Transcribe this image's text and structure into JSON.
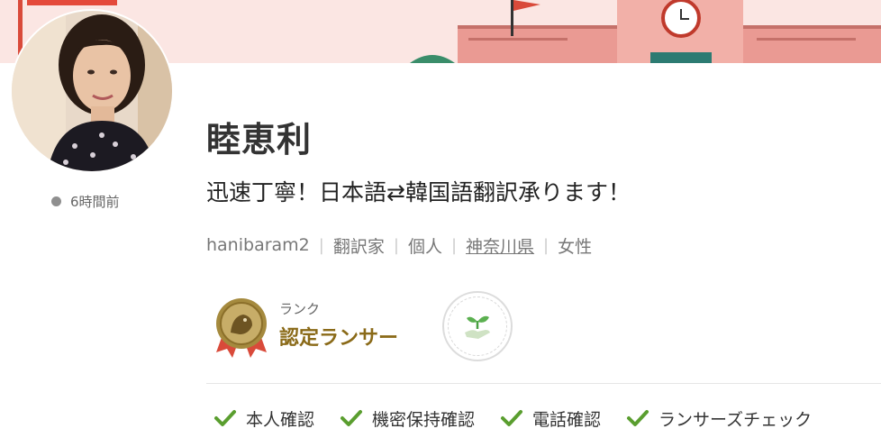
{
  "profile": {
    "name": "睦恵利",
    "catchphrase": "迅速丁寧！日本語⇄韓国語翻訳承ります！",
    "last_login": "6時間前",
    "meta": {
      "username": "hanibaram2",
      "occupation": "翻訳家",
      "type": "個人",
      "prefecture": "神奈川県",
      "gender": "女性"
    }
  },
  "rank": {
    "caption": "ランク",
    "name": "認定ランサー"
  },
  "verifications": [
    {
      "label": "本人確認"
    },
    {
      "label": "機密保持確認"
    },
    {
      "label": "電話確認"
    },
    {
      "label": "ランサーズチェック"
    }
  ],
  "colors": {
    "banner_bg": "#fbe6e3",
    "rank_gold": "#8a6a18",
    "check_green": "#5a9e2f"
  },
  "icons": {
    "status": "status-dot-icon",
    "rank": "rank-medal-icon",
    "sprout": "sprout-badge-icon",
    "check": "check-icon"
  }
}
